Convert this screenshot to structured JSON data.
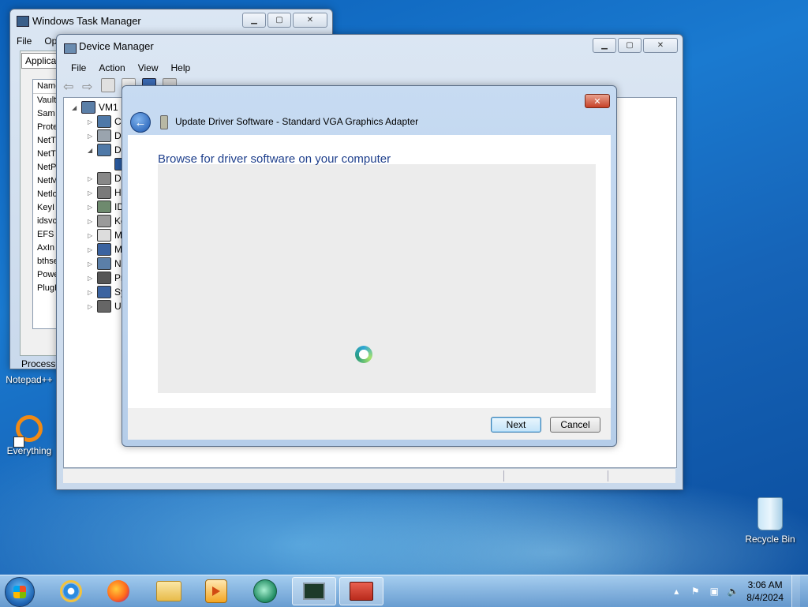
{
  "desktop": {
    "icons": [
      {
        "label": "Notepad++"
      },
      {
        "label": "Everything"
      },
      {
        "label": "Recycle Bin"
      }
    ]
  },
  "task_manager": {
    "title": "Windows Task Manager",
    "menu": [
      "File",
      "Op"
    ],
    "tab": "Applicati",
    "column_header": "Name",
    "rows": [
      "Vault",
      "Sam",
      "Prote",
      "NetT",
      "NetT",
      "NetP",
      "NetM",
      "Netlo",
      "KeyI",
      "idsvc",
      "EFS",
      "AxIn",
      "bthse",
      "Powe",
      "PlugP"
    ],
    "status": "Processes"
  },
  "device_manager": {
    "title": "Device Manager",
    "menu": [
      "File",
      "Action",
      "View",
      "Help"
    ],
    "tree": {
      "root": "VM1",
      "children": [
        "Co",
        "Di",
        "Di",
        "",
        "DV",
        "Hu",
        "ID",
        "Ke",
        "M",
        "M",
        "Ne",
        "Pr",
        "Sy",
        "Ur"
      ]
    }
  },
  "wizard": {
    "title": "Update Driver Software - Standard VGA Graphics Adapter",
    "heading": "Browse for driver software on your computer",
    "next_label": "Next",
    "cancel_label": "Cancel",
    "close_glyph": "✕",
    "back_glyph": "←"
  },
  "taskbar": {
    "apps": [
      "Internet Explorer",
      "Firefox",
      "Windows Explorer",
      "Media Player",
      "App",
      "Task Manager",
      "Device Manager"
    ],
    "clock_time": "3:06 AM",
    "clock_date": "8/4/2024"
  },
  "colors": {
    "heading_blue": "#1e3f8c",
    "desktop_blue": "#1a7ad0"
  }
}
